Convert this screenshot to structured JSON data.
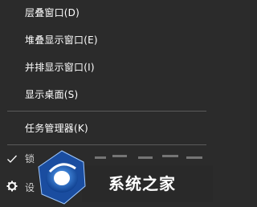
{
  "menu": {
    "items": [
      {
        "label": "层叠窗口(D)"
      },
      {
        "label": "堆叠显示窗口(E)"
      },
      {
        "label": "并排显示窗口(I)"
      },
      {
        "label": "显示桌面(S)"
      },
      {
        "label": "任务管理器(K)"
      },
      {
        "label": "锁",
        "icon": "check-icon"
      },
      {
        "label": "设",
        "icon": "gear-icon"
      }
    ]
  },
  "watermark": {
    "text": "系统之家",
    "logo": "xitongzhijia-logo"
  },
  "colors": {
    "background": "#2b2b2b",
    "text": "#ffffff",
    "separator": "#5a5a5a",
    "logo_blue": "#1f5fb5"
  }
}
